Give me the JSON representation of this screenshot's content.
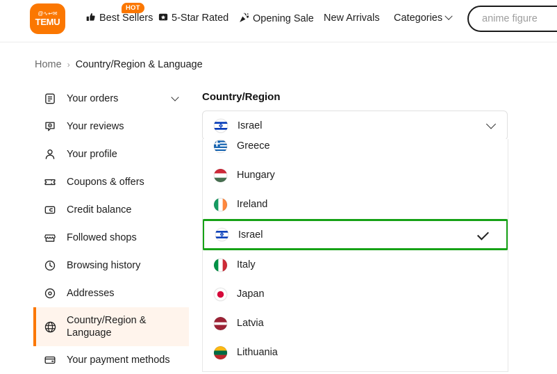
{
  "header": {
    "logo": {
      "glyphs": "@∿↩✉",
      "wordmark": "TEMU",
      "color": "#fb7701"
    },
    "nav": [
      {
        "id": "best-sellers",
        "icon": "thumbs-up",
        "glyph": "👍",
        "label": "Best Sellers",
        "badge": "HOT"
      },
      {
        "id": "five-star-rated",
        "icon": "star-badge",
        "glyph": "⬛",
        "label": "5-Star Rated"
      },
      {
        "id": "opening-sale",
        "icon": "party-popper",
        "glyph": "🎉",
        "label": "Opening Sale"
      },
      {
        "id": "new-arrivals",
        "icon": null,
        "label": "New Arrivals"
      },
      {
        "id": "categories",
        "icon": "chevron-down",
        "label": "Categories"
      }
    ],
    "search": {
      "placeholder": "anime figure",
      "value": ""
    }
  },
  "breadcrumb": {
    "home": "Home",
    "separator": "›",
    "current": "Country/Region & Language"
  },
  "sidebar": {
    "items": [
      {
        "id": "your-orders",
        "icon": "orders-icon",
        "label": "Your orders",
        "chevron": true
      },
      {
        "id": "your-reviews",
        "icon": "review-bubble-icon",
        "label": "Your reviews"
      },
      {
        "id": "your-profile",
        "icon": "person-icon",
        "label": "Your profile"
      },
      {
        "id": "coupons-offers",
        "icon": "ticket-icon",
        "label": "Coupons & offers"
      },
      {
        "id": "credit-balance",
        "icon": "wallet-icon",
        "label": "Credit balance"
      },
      {
        "id": "followed-shops",
        "icon": "storefront-icon",
        "label": "Followed shops"
      },
      {
        "id": "browsing-history",
        "icon": "clock-icon",
        "label": "Browsing history"
      },
      {
        "id": "addresses",
        "icon": "location-pin-icon",
        "label": "Addresses"
      },
      {
        "id": "country-region-language",
        "icon": "globe-icon",
        "label": "Country/Region &\nLanguage",
        "active": true
      },
      {
        "id": "your-payment-methods",
        "icon": "credit-card-icon",
        "label": "Your payment methods"
      }
    ],
    "active_accent": "#fb7701",
    "active_background": "#fff4ec"
  },
  "main": {
    "title": "Country/Region",
    "select": {
      "value": "Israel",
      "flag": "israel",
      "chevron": "chevron-down-icon"
    }
  },
  "dropdown": {
    "selected_color": "#16a216",
    "check_icon": "check-icon",
    "options": [
      {
        "name": "Greece",
        "flag": "greece",
        "selected": false
      },
      {
        "name": "Hungary",
        "flag": "hungary",
        "selected": false
      },
      {
        "name": "Ireland",
        "flag": "ireland",
        "selected": false
      },
      {
        "name": "Israel",
        "flag": "israel",
        "selected": true
      },
      {
        "name": "Italy",
        "flag": "italy",
        "selected": false
      },
      {
        "name": "Japan",
        "flag": "japan",
        "selected": false
      },
      {
        "name": "Latvia",
        "flag": "latvia",
        "selected": false
      },
      {
        "name": "Lithuania",
        "flag": "lithuania",
        "selected": false
      }
    ]
  }
}
